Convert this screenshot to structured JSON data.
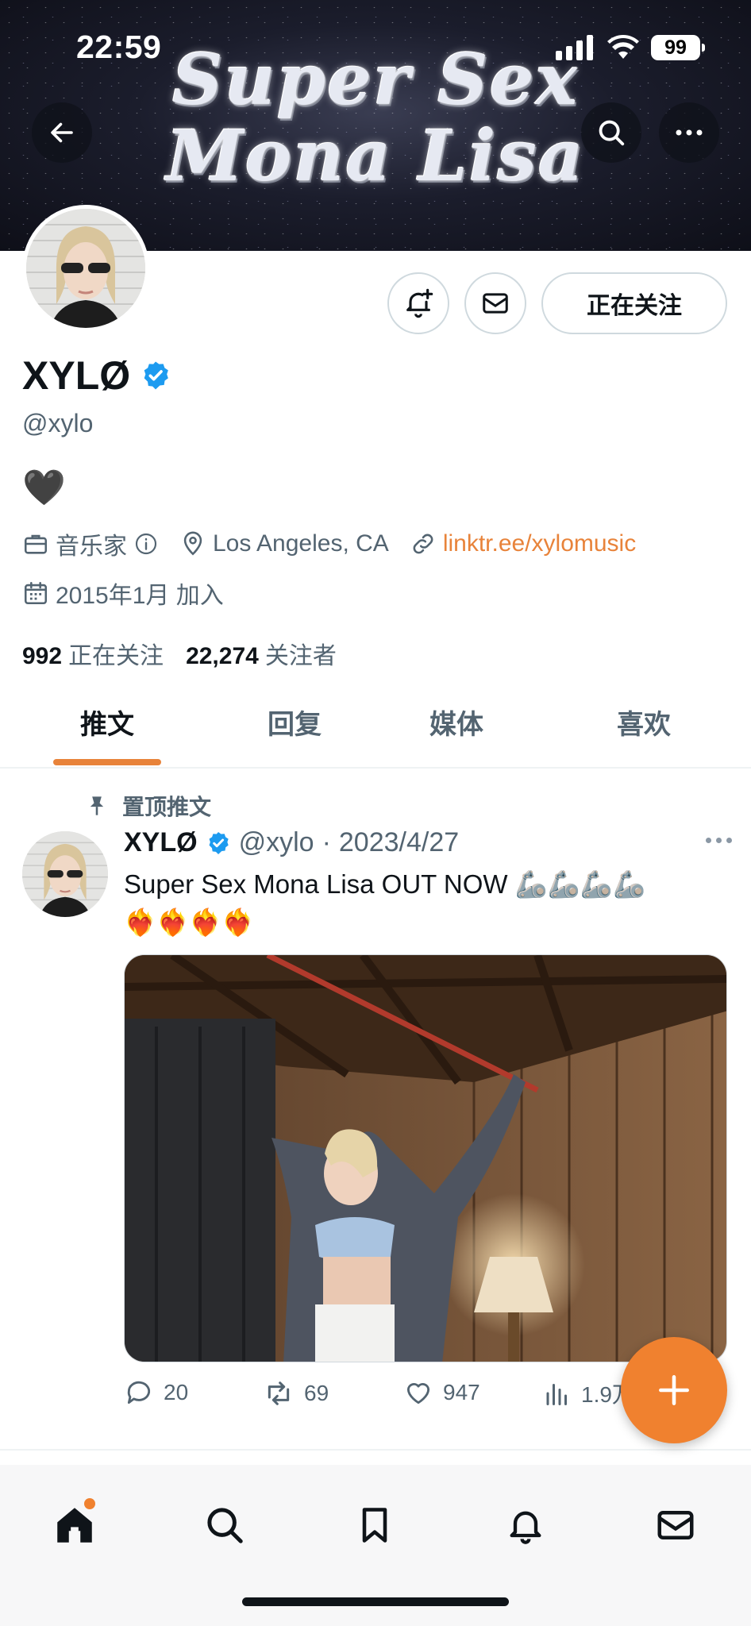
{
  "status_bar": {
    "time": "22:59",
    "battery": "99"
  },
  "banner": {
    "title_line1": "Super Sex",
    "title_line2": "Mona Lisa"
  },
  "profile": {
    "display_name": "XYLØ",
    "handle": "@xylo",
    "bio": "🖤",
    "category": "音乐家",
    "location": "Los Angeles, CA",
    "link": "linktr.ee/xylomusic",
    "joined": "2015年1月 加入",
    "following_count": "992",
    "following_label": "正在关注",
    "followers_count": "22,274",
    "followers_label": "关注者",
    "follow_button": "正在关注"
  },
  "tabs": [
    {
      "label": "推文",
      "active": true
    },
    {
      "label": "回复",
      "active": false
    },
    {
      "label": "媒体",
      "active": false
    },
    {
      "label": "喜欢",
      "active": false
    }
  ],
  "pinned_tweet": {
    "pinned_label": "置顶推文",
    "author_name": "XYLØ",
    "author_handle": "@xylo",
    "separator": "·",
    "date": "2023/4/27",
    "text_line1": "Super Sex Mona Lisa OUT NOW 🦾🦾🦾🦾",
    "text_line2": "❤️‍🔥❤️‍🔥❤️‍🔥❤️‍🔥",
    "replies": "20",
    "retweets": "69",
    "likes": "947",
    "views": "1.9万"
  },
  "colors": {
    "accent": "#e8833a",
    "fab": "#f0812f",
    "verified": "#1d9bf0",
    "muted": "#536471"
  },
  "icons": {
    "nav": [
      "home-icon",
      "search-icon",
      "bookmark-icon",
      "bell-icon",
      "mail-icon"
    ],
    "header": [
      "back-arrow-icon",
      "search-icon",
      "more-icon"
    ]
  }
}
